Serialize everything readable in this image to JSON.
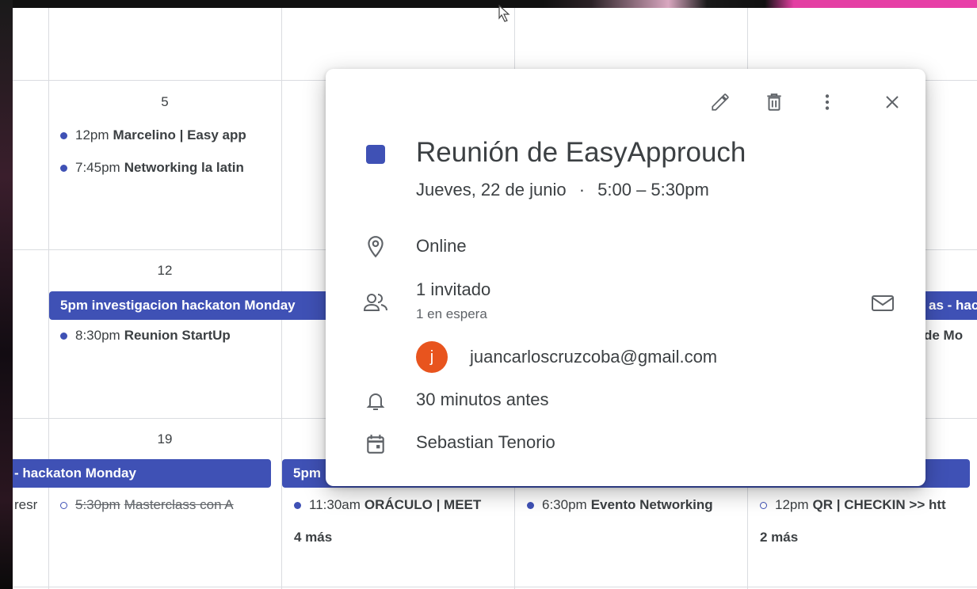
{
  "calendar": {
    "days": {
      "d5": "5",
      "d12": "12",
      "d19": "19"
    },
    "events": {
      "e1": {
        "time": "12pm",
        "title": "Marcelino | Easy app"
      },
      "e2": {
        "time": "7:45pm",
        "title": "Networking la latin"
      },
      "e3": {
        "time": "8:30pm",
        "title": "Reunion StartUp"
      },
      "e4": {
        "time": "5:30pm",
        "title": "Masterclass con A"
      },
      "e5": {
        "time": "11:30am",
        "title": "ORÁCULO | MEET"
      },
      "e6": {
        "time": "6:30pm",
        "title": "Evento Networking"
      },
      "e7": {
        "time": "12pm",
        "title": "QR | CHECKIN >> htt"
      },
      "e_left": "resr",
      "e_right": "de Mo"
    },
    "bars": {
      "b1": "5pm investigacion hackaton Monday",
      "b2": "as - hac",
      "b3": "- hackaton Monday",
      "b4": "5pm"
    },
    "more": {
      "m1": "4 más",
      "m2": "2 más"
    }
  },
  "popup": {
    "toolbar": {
      "edit_icon": "pencil-icon",
      "delete_icon": "trash-icon",
      "more_icon": "more-vert-icon",
      "close_icon": "close-icon"
    },
    "color": "#3f51b5",
    "title": "Reunión de EasyApprouch",
    "date": "Jueves, 22 de junio",
    "separator": "·",
    "time": "5:00 – 5:30pm",
    "location": "Online",
    "guests_count": "1 invitado",
    "guests_status": "1 en espera",
    "guest_initial": "j",
    "guest_email": "juancarloscruzcoba@gmail.com",
    "reminder": "30 minutos antes",
    "organizer": "Sebastian Tenorio"
  }
}
